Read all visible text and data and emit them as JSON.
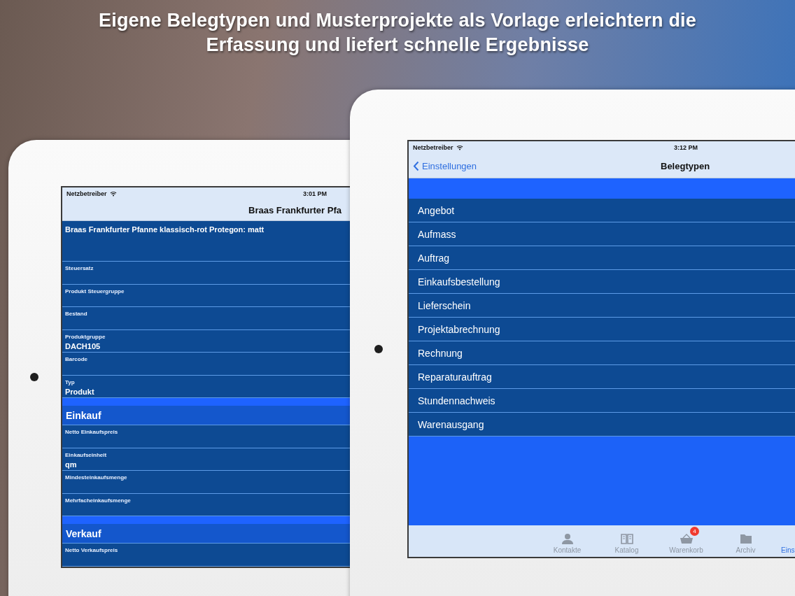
{
  "headline": [
    "Eigene Belegtypen und Musterprojekte als Vorlage erleichtern die",
    "Erfassung und liefert schnelle Ergebnisse"
  ],
  "left_device": {
    "status_bar": {
      "carrier": "Netzbetreiber",
      "time": "3:01 PM"
    },
    "nav_title": "Braas Frankfurter Pfa",
    "rows": [
      {
        "kind": "title",
        "text": "Braas Frankfurter Pfanne klassisch-rot Protegon: matt"
      },
      {
        "kind": "field",
        "label": "Steuersatz"
      },
      {
        "kind": "field",
        "label": "Produkt Steuergruppe"
      },
      {
        "kind": "field",
        "label": "Bestand"
      },
      {
        "kind": "field",
        "label": "Produktgruppe",
        "value": "DACH105"
      },
      {
        "kind": "field",
        "label": "Barcode"
      },
      {
        "kind": "field",
        "label": "Typ",
        "value": "Produkt"
      },
      {
        "kind": "section",
        "text": "Einkauf"
      },
      {
        "kind": "field",
        "label": "Netto Einkaufspreis"
      },
      {
        "kind": "field",
        "label": "Einkaufseinheit",
        "value": "qm"
      },
      {
        "kind": "field",
        "label": "Mindesteinkaufsmenge"
      },
      {
        "kind": "field",
        "label": "Mehrfacheinkaufsmenge"
      },
      {
        "kind": "section",
        "text": "Verkauf"
      },
      {
        "kind": "field",
        "label": "Netto Verkaufspreis"
      }
    ]
  },
  "right_device": {
    "status_bar": {
      "carrier": "Netzbetreiber",
      "time": "3:12 PM"
    },
    "back": "Einstellungen",
    "nav_title": "Belegtypen",
    "items": [
      "Angebot",
      "Aufmass",
      "Auftrag",
      "Einkaufsbestellung",
      "Lieferschein",
      "Projektabrechnung",
      "Rechnung",
      "Reparaturauftrag",
      "Stundennachweis",
      "Warenausgang"
    ],
    "tabs": [
      {
        "label": "Kontakte",
        "selected": false
      },
      {
        "label": "Katalog",
        "selected": false
      },
      {
        "label": "Warenkorb",
        "selected": false,
        "badge": "4"
      },
      {
        "label": "Archiv",
        "selected": false
      },
      {
        "label": "Eins",
        "selected": true
      }
    ]
  }
}
